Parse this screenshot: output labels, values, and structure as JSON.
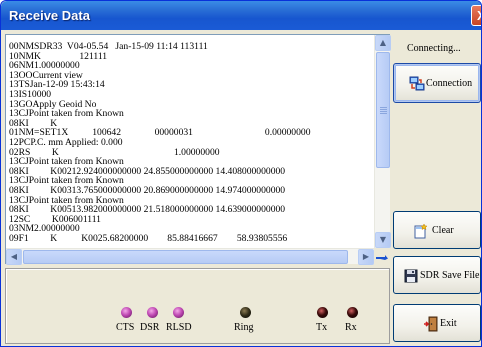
{
  "window": {
    "title": "Receive Data",
    "close_glyph": "X"
  },
  "log_lines": [
    "00NMSDR33  V04-05.54   Jan-15-09 11:14 113111",
    "10NMK                121111",
    "06NM1.00000000",
    "13OOCurrent view",
    "13TSJan-12-09 15:43:14",
    "13IS10000",
    "13GOApply Geoid No",
    "13CJPoint taken from Known",
    "08KI         K",
    "01NM=SET1X          100642              00000031                              0.00000000",
    "12PCP.C. mm Applied: 0.000",
    "02RS         K                                                1.00000000",
    "13CJPoint taken from Known",
    "08KI         K00212.924000000000 24.855000000000 14.408000000000",
    "13CJPoint taken from Known",
    "08KI         K00313.765000000000 20.869000000000 14.974000000000",
    "13CJPoint taken from Known",
    "08KI         K00513.982000000000 21.518000000000 14.639000000000",
    "12SC         K006001111",
    "03NM2.00000000",
    "09F1         K          K0025.68200000        85.88416667        58.93805556"
  ],
  "status": {
    "connection_state": "Connecting..."
  },
  "buttons": {
    "connection": "Connection",
    "clear": "Clear",
    "sdr_save_file": "SDR Save File",
    "exit": "Exit"
  },
  "indicators": {
    "cts": "CTS",
    "dsr": "DSR",
    "rlsd": "RLSD",
    "ring": "Ring",
    "tx": "Tx",
    "rx": "Rx"
  },
  "icons": {
    "connection": "connection-computer-icon",
    "clear": "clear-document-icon",
    "save": "floppy-disk-icon",
    "exit": "exit-door-icon"
  },
  "colors": {
    "title_bar": "#2a6fd6",
    "led_active": "#c04ab4",
    "led_off": "#2e2a16",
    "led_tx_rx": "#3a0a0a"
  }
}
